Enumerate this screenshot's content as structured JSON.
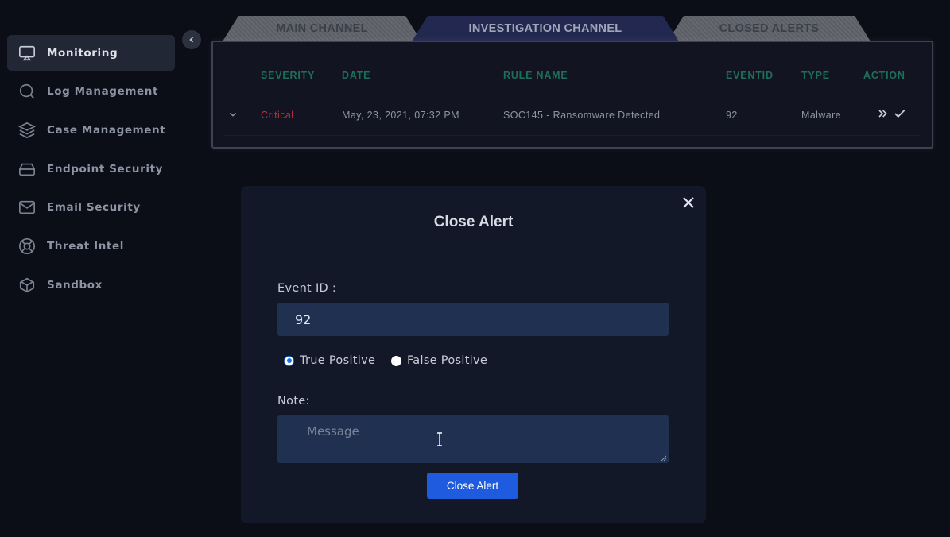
{
  "sidebar": {
    "items": [
      {
        "label": "Monitoring",
        "icon": "monitor-icon",
        "active": true
      },
      {
        "label": "Log Management",
        "icon": "search-icon"
      },
      {
        "label": "Case Management",
        "icon": "layers-icon"
      },
      {
        "label": "Endpoint Security",
        "icon": "hard-drive-icon"
      },
      {
        "label": "Email Security",
        "icon": "mail-icon"
      },
      {
        "label": "Threat Intel",
        "icon": "lifebuoy-icon"
      },
      {
        "label": "Sandbox",
        "icon": "box-icon"
      }
    ]
  },
  "tabs": {
    "main": "MAIN CHANNEL",
    "investigation": "INVESTIGATION CHANNEL",
    "closed": "CLOSED ALERTS"
  },
  "table": {
    "headers": {
      "severity": "SEVERITY",
      "date": "DATE",
      "rule_name": "RULE NAME",
      "eventid": "EVENTID",
      "type": "TYPE",
      "action": "ACTION"
    },
    "row": {
      "severity": "Critical",
      "date": "May, 23, 2021, 07:32 PM",
      "rule_name": "SOC145 - Ransomware Detected",
      "eventid": "92",
      "type": "Malware"
    }
  },
  "modal": {
    "title": "Close Alert",
    "event_id_label": "Event ID :",
    "event_id_value": "92",
    "radio_true": "True Positive",
    "radio_false": "False Positive",
    "note_label": "Note:",
    "note_placeholder": "Message",
    "submit_label": "Close Alert"
  },
  "colors": {
    "accent": "#1e5bdf",
    "header_green": "#1f6e5a",
    "critical_red": "#c0323a",
    "active_tab": "#232850"
  }
}
